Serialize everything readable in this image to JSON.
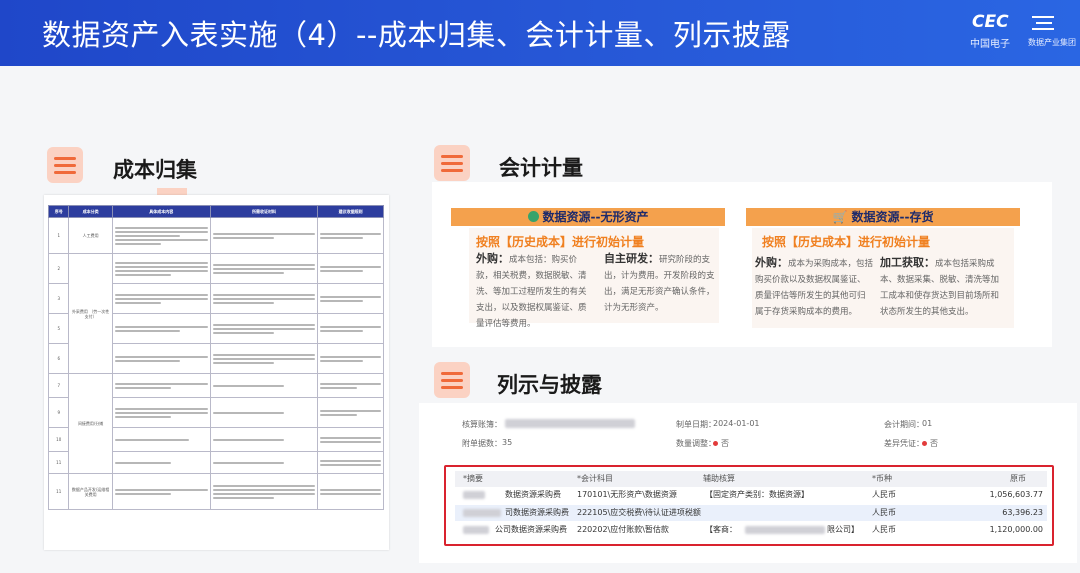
{
  "title": "数据资产入表实施（4）--成本归集、会计计量、列示披露",
  "logo": {
    "mark": "CEC",
    "org": "中国电子",
    "sub": "数据产业集团"
  },
  "sections": {
    "cost": "成本归集",
    "measure": "会计计量",
    "disclosure": "列示与披露"
  },
  "cost_table": {
    "headers": [
      "序号",
      "成本分类",
      "具体成本内容",
      "所需收证材料",
      "建议收据规则"
    ],
    "rows": [
      {
        "no": "1",
        "category": "人工费用"
      },
      {
        "no": "2",
        "category": ""
      },
      {
        "no": "3",
        "category": ""
      },
      {
        "no": "4",
        "category": "外采费用\n（劳一次性支付）"
      },
      {
        "no": "5",
        "category": ""
      },
      {
        "no": "6",
        "category": ""
      },
      {
        "no": "7",
        "category": ""
      },
      {
        "no": "8",
        "category": "间接费用/分摊"
      },
      {
        "no": "9",
        "category": ""
      },
      {
        "no": "10",
        "category": ""
      },
      {
        "no": "11",
        "category": "数据产品开发/运维相关费用"
      }
    ]
  },
  "measure": {
    "card1": {
      "header": "数据资源--无形资产",
      "sub": "按照【历史成本】进行初始计量",
      "p1_label": "外购：",
      "p1": "成本包括：购买价款，相关税费，数据脱敏、清洗、等加工过程所发生的有关支出，以及数据权属鉴证、质量评估等费用。",
      "p2_label": "自主研发：",
      "p2": "研究阶段的支出，计为费用。开发阶段的支出，满足无形资产确认条件，计为无形资产。"
    },
    "card2": {
      "header": "数据资源--存货",
      "sub": "按照【历史成本】进行初始计量",
      "p1_label": "外购：",
      "p1": "成本为采购成本，包括购买价款以及数据权属鉴证、质量评估等所发生的其他可归属于存货采购成本的费用。",
      "p2_label": "加工获取：",
      "p2": "成本包括采购成本、数据采集、脱敏、清洗等加工成本和使存货达到目前场所和状态所发生的其他支出。"
    }
  },
  "voucher": {
    "book_label": "核算账簿：",
    "date_label": "制单日期：",
    "date": "2024-01-01",
    "period_label": "会计期间：",
    "period": "01",
    "attach_label": "附单据数：",
    "attach": "35",
    "qty_label": "数量调整：",
    "qty": "否",
    "diff_label": "差异凭证：",
    "diff": "否",
    "columns": [
      "*摘要",
      "*会计科目",
      "辅助核算",
      "*币种",
      "原币"
    ],
    "rows": [
      {
        "summary": "数据资源采购费",
        "account": "170101\\无形资产\\数据资源",
        "aux": "【固定资产类别：数据资源】",
        "currency": "人民币",
        "amount": "1,056,603.77"
      },
      {
        "summary": "司数据资源采购费",
        "account": "222105\\应交税费\\待认证进项税额",
        "aux": "",
        "currency": "人民币",
        "amount": "63,396.23"
      },
      {
        "summary": "公司数据资源采购费",
        "account": "220202\\应付账款\\暂估款",
        "aux": "【客商：",
        "aux_end": "限公司】",
        "currency": "人民币",
        "amount": "1,120,000.00"
      }
    ]
  }
}
